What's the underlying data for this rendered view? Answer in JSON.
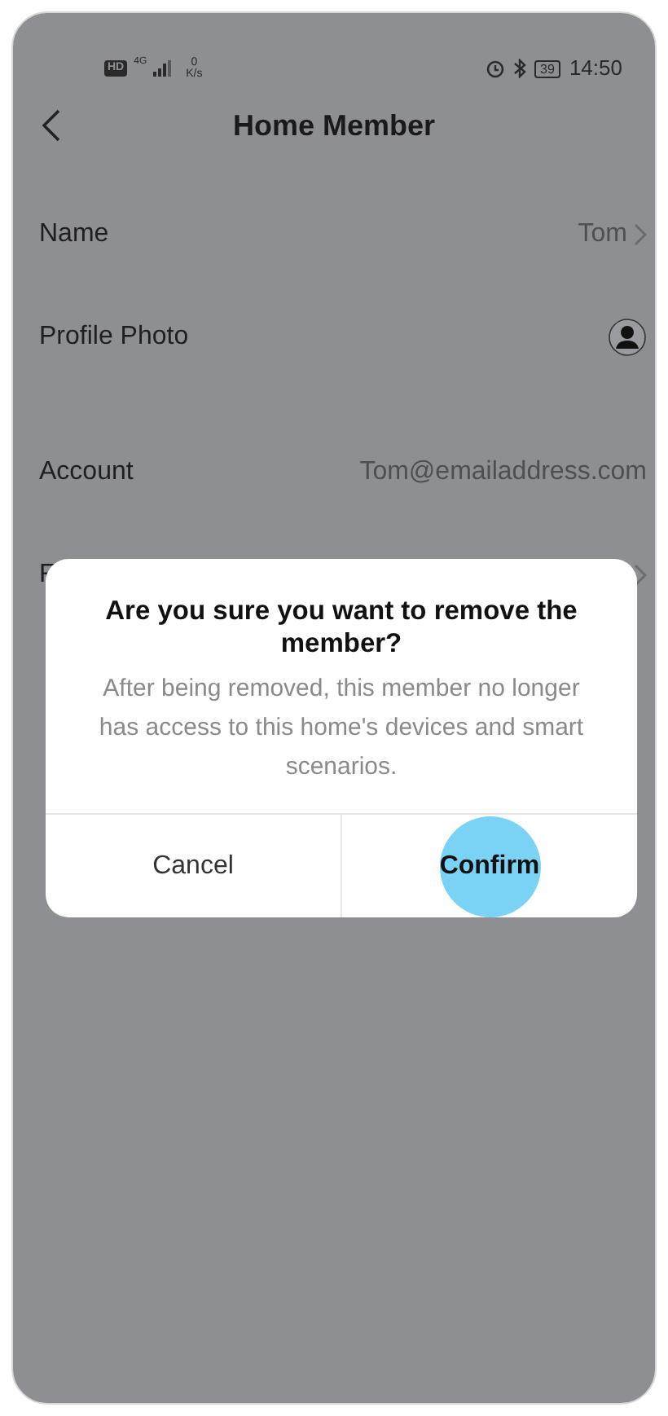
{
  "status_bar": {
    "network_badge": "HD",
    "network_type": "4G",
    "speed_value": "0",
    "speed_unit": "K/s",
    "battery": "39",
    "time": "14:50"
  },
  "header": {
    "title": "Home Member"
  },
  "rows": [
    {
      "kind": "text",
      "label": "Name",
      "value": "Tom",
      "chevron": true
    },
    {
      "kind": "avatar",
      "label": "Profile Photo"
    },
    {
      "kind": "text",
      "label": "Account",
      "value": "Tom@emailaddress.com",
      "chevron": false,
      "section_gap": true
    },
    {
      "kind": "text",
      "label": "F",
      "chevron": true
    }
  ],
  "dialog": {
    "title": "Are you sure you want to remove the member?",
    "message": "After being removed, this member no longer has access to this home's devices and smart scenarios.",
    "buttons": [
      {
        "label": "Cancel",
        "primary": false,
        "tapped": false
      },
      {
        "label": "Confirm",
        "primary": true,
        "tapped": true
      }
    ]
  }
}
